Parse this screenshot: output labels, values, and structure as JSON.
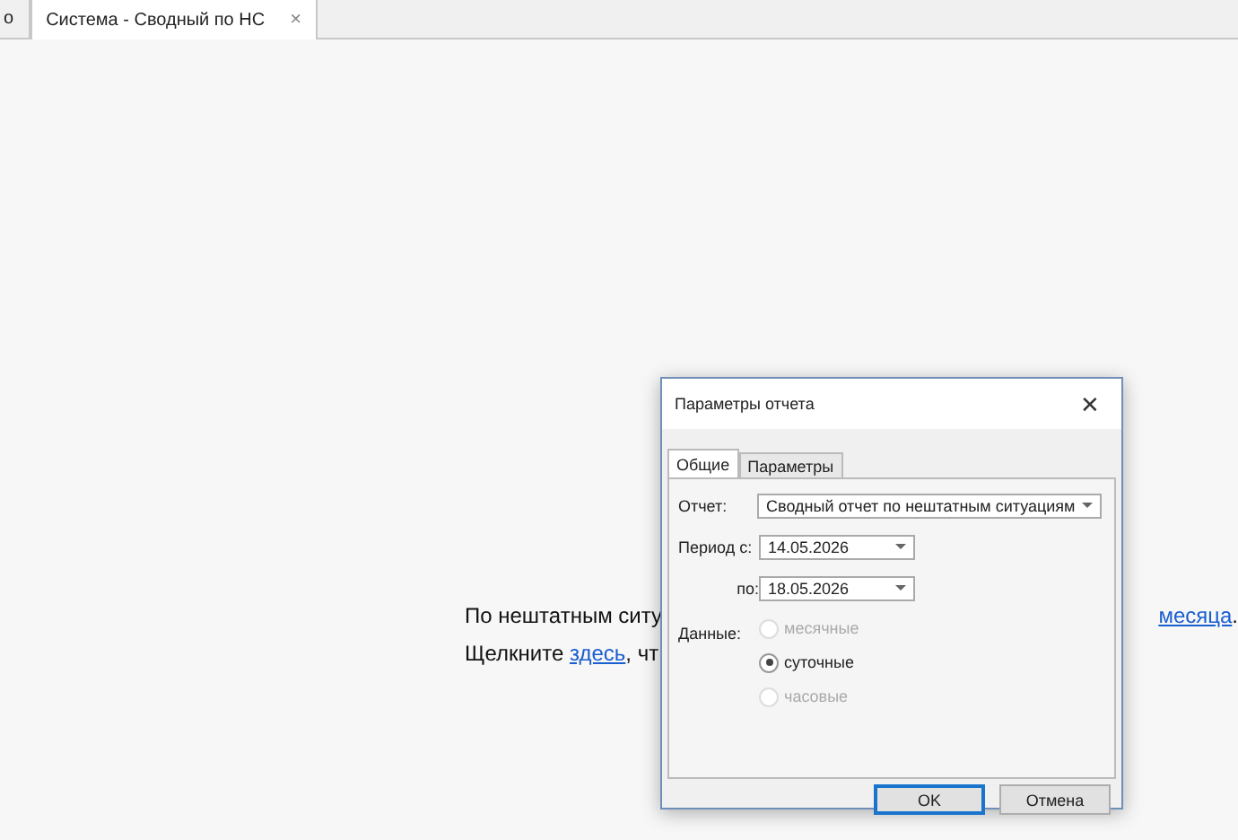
{
  "tabs": [
    {
      "label": "о",
      "selected": false
    },
    {
      "label": "Система - Сводный по НС",
      "selected": true,
      "close": "×"
    }
  ],
  "message": {
    "line_1_start": "По нештатным ситу",
    "line_1_link": "месяца",
    "line_1_end": ".",
    "line_2_start": "Щелкните ",
    "line_2_link": "здесь",
    "line_2_end": ", чт"
  },
  "dialog": {
    "title": "Параметры отчета",
    "close": "✕",
    "tabs": [
      {
        "label": "Общие",
        "selected": true
      },
      {
        "label": "Параметры",
        "selected": false
      }
    ],
    "report_label": "Отчет:",
    "report_value": "Сводный отчет по нештатным ситуациям",
    "period_from_label": "Период с:",
    "period_from": "14.05.2026",
    "period_to_label": "по:",
    "period_to": "18.05.2026",
    "data_label": "Данные:",
    "data_options": [
      {
        "label": "месячные",
        "selected": false,
        "disabled": true
      },
      {
        "label": "суточные",
        "selected": true,
        "disabled": false
      },
      {
        "label": "часовые",
        "selected": false,
        "disabled": true
      }
    ],
    "buttons": [
      {
        "label": "OK",
        "default": true
      },
      {
        "label": "Отмена",
        "default": false
      }
    ]
  }
}
